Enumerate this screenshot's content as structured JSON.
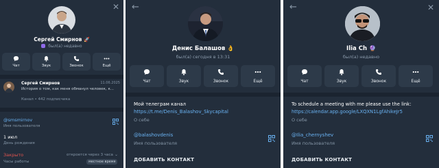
{
  "panel1": {
    "name": "Сергей Смирнов",
    "name_emoji": "🚀",
    "status": "был(а) недавно",
    "buttons": [
      {
        "label": "Чат",
        "icon": "chat-icon"
      },
      {
        "label": "Звук",
        "icon": "bell-icon"
      },
      {
        "label": "Звонок",
        "icon": "phone-icon"
      },
      {
        "label": "Ещё",
        "icon": "more-icon"
      }
    ],
    "channel_post": {
      "author": "Сергей Смирнов",
      "date": "11.06.2025",
      "text": "История о том, как меня обманул человек, к...",
      "meta": "Канал • 442 подписчика"
    },
    "username_value": "@smsmirnov",
    "username_label": "Имя пользователя",
    "birthday_value": "1 июл",
    "birthday_label": "День рождения",
    "hours_status": "Закрыто",
    "hours_opens": "откроется через 3 часа",
    "hours_label": "Часы работы",
    "hours_badge": "местное время"
  },
  "panel2": {
    "name": "Денис Балашов",
    "name_emoji": "👌",
    "status": "был(а) сегодня в 13:31",
    "buttons": [
      {
        "label": "Чат",
        "icon": "chat-icon"
      },
      {
        "label": "Звук",
        "icon": "bell-icon"
      },
      {
        "label": "Звонок",
        "icon": "phone-icon"
      },
      {
        "label": "Ещё",
        "icon": "more-icon"
      }
    ],
    "bio_text": "Мой телеграм канал",
    "bio_link": "https://t.me/Denis_Balashov_Skycapital",
    "bio_label": "О себе",
    "username_value": "@balashovdenis",
    "username_label": "Имя пользователя",
    "add_contact": "ДОБАВИТЬ КОНТАКТ"
  },
  "panel3": {
    "name": "Ilia Ch",
    "name_emoji": "🔮",
    "status": "был(а) недавно",
    "buttons": [
      {
        "label": "Чат",
        "icon": "chat-icon"
      },
      {
        "label": "Звук",
        "icon": "bell-icon"
      },
      {
        "label": "Звонок",
        "icon": "phone-icon"
      },
      {
        "label": "Ещё",
        "icon": "more-icon"
      }
    ],
    "bio_text": "To schedule a meeting with me please use the link:",
    "bio_link": "https://calendar.app.google/LXQXN1LgfAhikeJr5",
    "bio_label": "О себе",
    "username_value": "@Ilia_chernyshev",
    "username_label": "Имя пользователя",
    "add_contact": "ДОБАВИТЬ КОНТАКТ"
  },
  "colors": {
    "background": "#232e3c",
    "button": "#2d3a49",
    "separator": "#1b2430",
    "link": "#6ab3f3",
    "muted": "#8495a6",
    "closed": "#e0544f",
    "emoji_status": "#8f6be8"
  },
  "icons": {
    "close": "✕",
    "back": "←"
  }
}
